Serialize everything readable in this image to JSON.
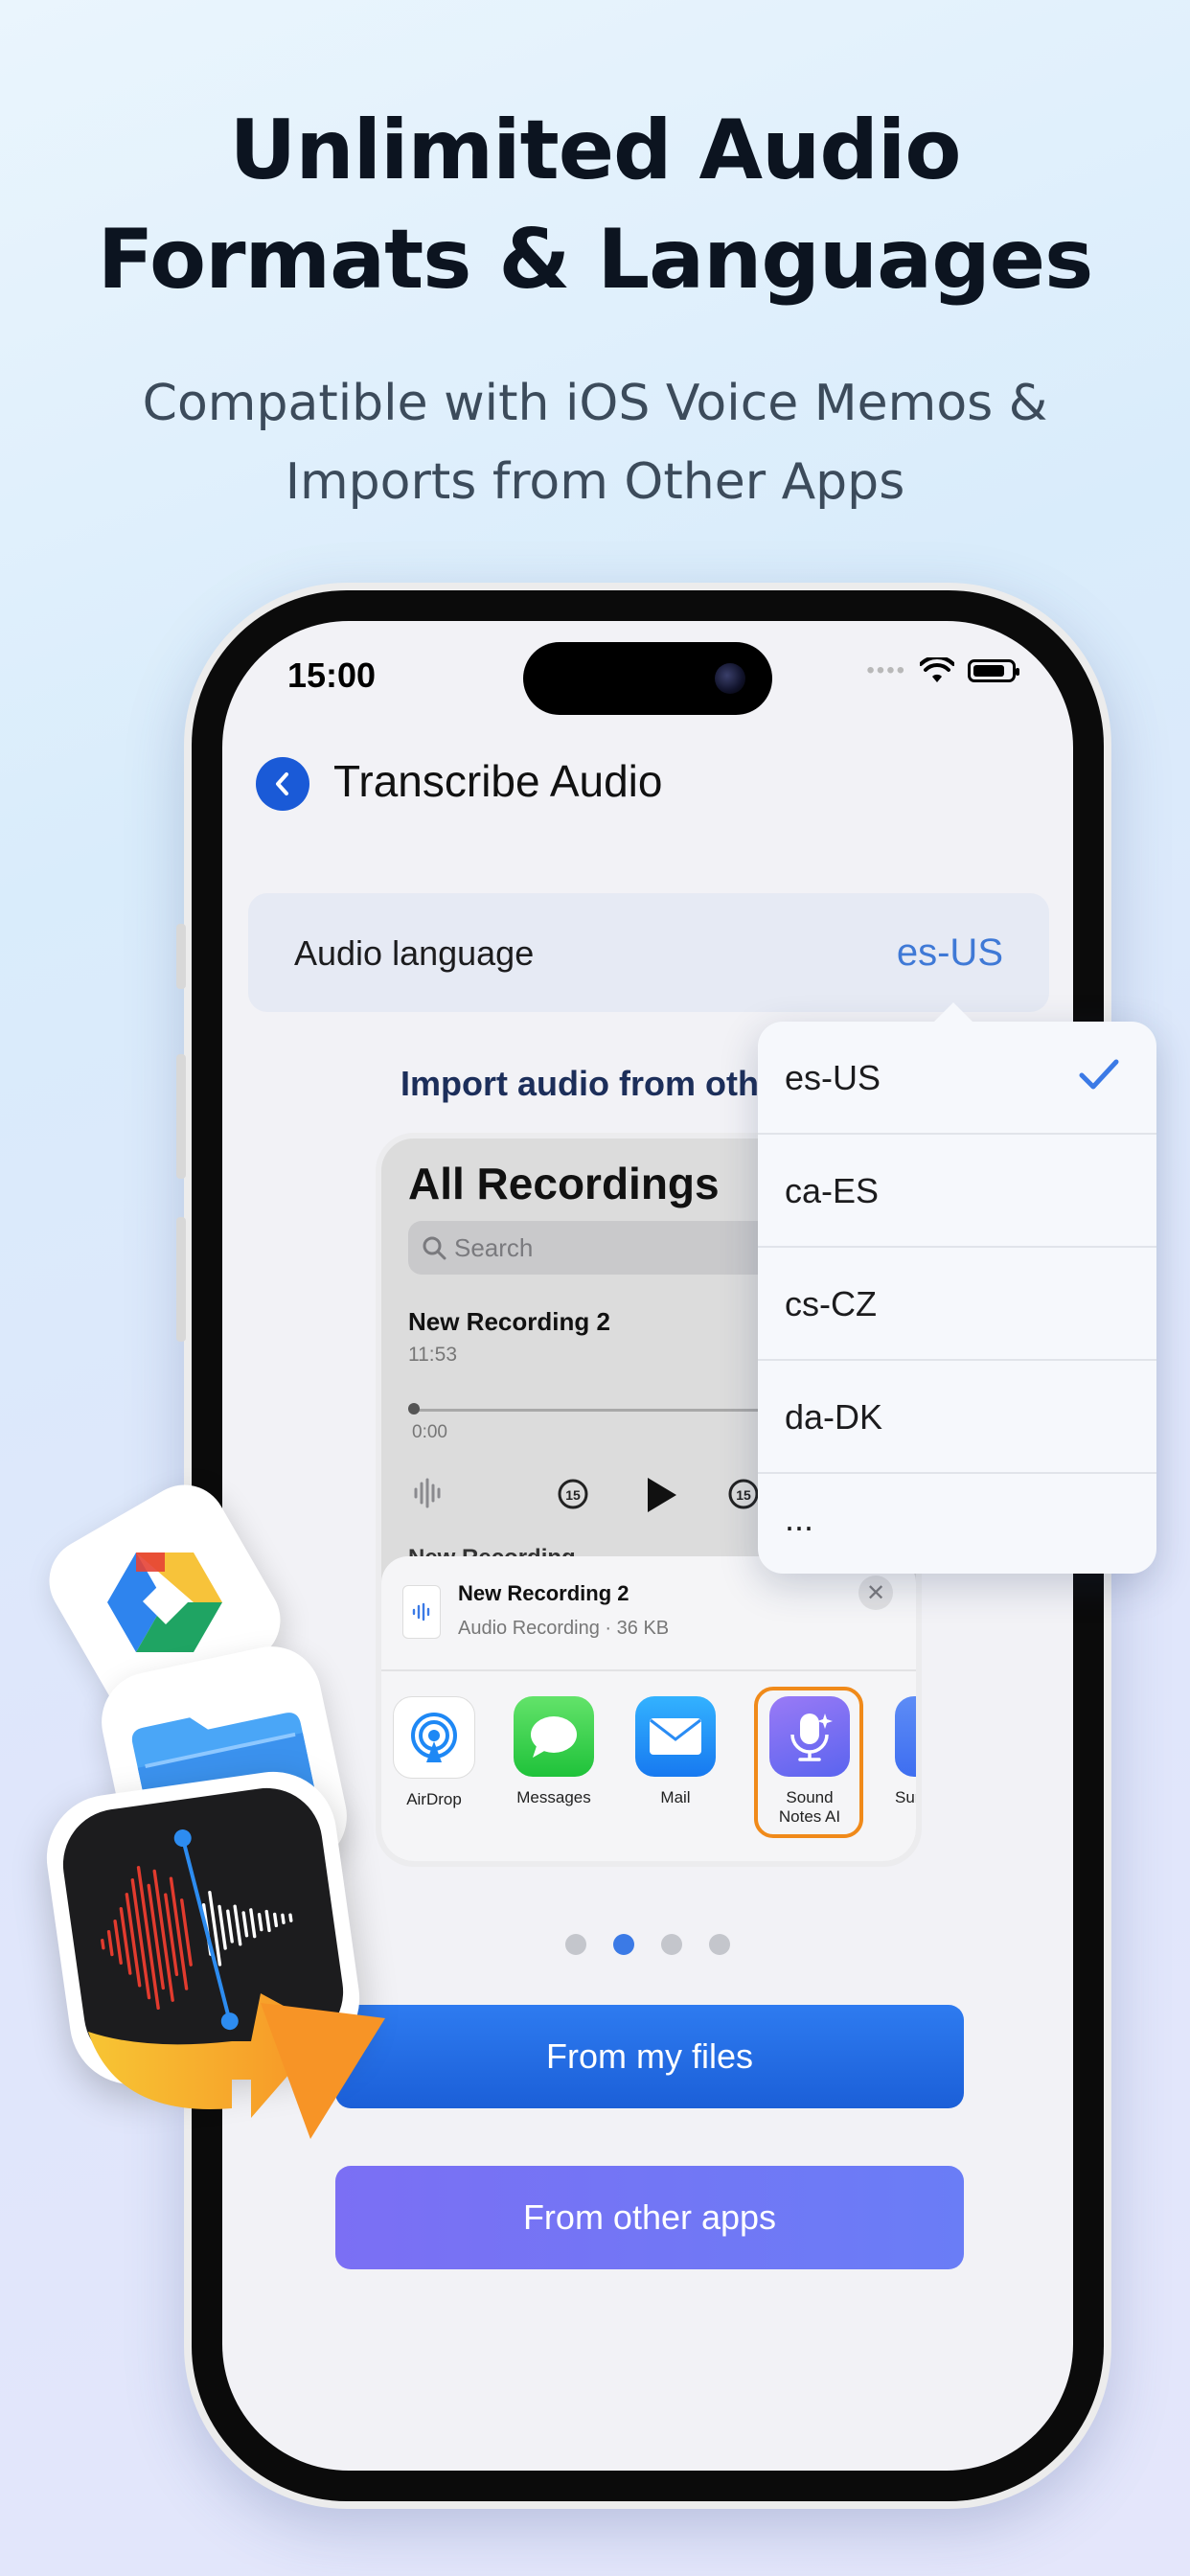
{
  "headline": {
    "line1": "Unlimited Audio",
    "line2": "Formats & Languages"
  },
  "subhead": {
    "line1": "Compatible with iOS Voice Memos &",
    "line2": "Imports from Other Apps"
  },
  "status_bar": {
    "time": "15:00",
    "signal": "••••"
  },
  "nav": {
    "title": "Transcribe Audio"
  },
  "language_row": {
    "label": "Audio language",
    "value": "es-US"
  },
  "import_title": "Import audio from oth",
  "voice_memos_mock": {
    "title": "All Recordings",
    "search_placeholder": "Search",
    "recording_1": {
      "name": "New Recording 2",
      "time": "11:53",
      "position": "0:00"
    },
    "recording_2_name": "New Recording",
    "skip_back": "15",
    "skip_forward": "15"
  },
  "share_sheet": {
    "file_name": "New Recording 2",
    "file_meta": "Audio Recording · 36 KB",
    "apps": [
      {
        "label": "AirDrop"
      },
      {
        "label": "Messages"
      },
      {
        "label": "Mail"
      },
      {
        "label_line1": "Sound",
        "label_line2": "Notes AI"
      },
      {
        "label": "Sum"
      }
    ]
  },
  "dropdown": {
    "options": [
      "es-US",
      "ca-ES",
      "cs-CZ",
      "da-DK",
      "..."
    ],
    "selected": "es-US"
  },
  "pager": {
    "count": 4,
    "active_index": 1
  },
  "buttons": {
    "from_files": "From my files",
    "from_apps": "From other apps"
  },
  "colors": {
    "accent_blue": "#1b5fd8",
    "purple": "#7b6ff4",
    "highlight_orange": "#f08a1a",
    "lang_value": "#3f79d6"
  }
}
